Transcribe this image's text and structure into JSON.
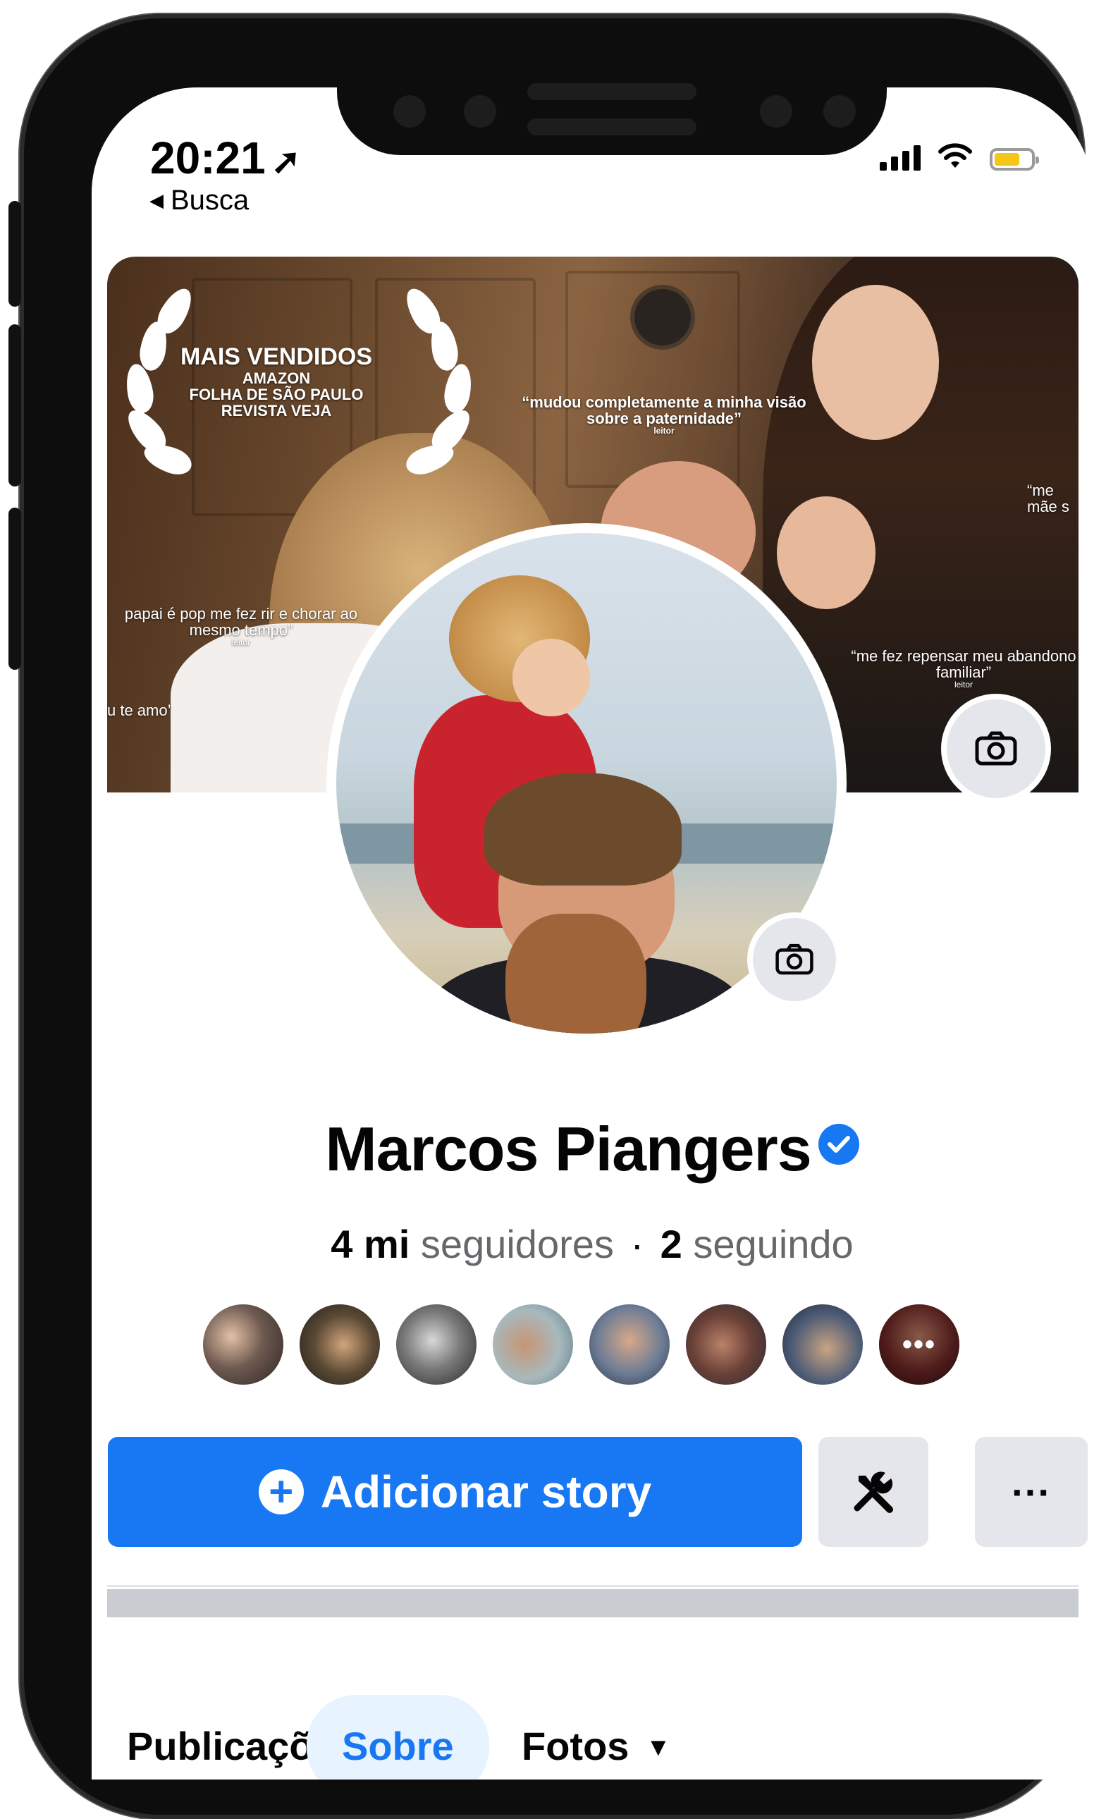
{
  "status_bar": {
    "time": "20:21",
    "back_label": "Busca",
    "battery_color": "#f5c518"
  },
  "cover": {
    "award_title": "MAIS VENDIDOS",
    "award_line1": "AMAZON",
    "award_line2": "FOLHA DE SÃO PAULO",
    "award_line3": "REVISTA VEJA",
    "quote1": "“mudou completamente a minha visão sobre a paternidade”",
    "quote1_attr": "leitor",
    "quote2": "papai é pop me fez rir e chorar ao mesmo tempo”",
    "quote2_attr": "leitor",
    "quote3": "“me fez repensar meu abandono familiar”",
    "quote3_attr": "leitor",
    "quote4": "“me",
    "quote4b": "mãe s",
    "quote5": "u te amo’"
  },
  "profile": {
    "name": "Marcos Piangers",
    "verified": true,
    "followers_count": "4 mi",
    "followers_label": "seguidores",
    "separator": "·",
    "following_count": "2",
    "following_label": "seguindo",
    "friend_more": "•••"
  },
  "actions": {
    "add_story": "Adicionar story",
    "more": "···"
  },
  "tabs": [
    {
      "label": "Publicações"
    },
    {
      "label": "Sobre"
    },
    {
      "label": "Fotos"
    }
  ],
  "colors": {
    "accent": "#1877f2",
    "button_gray": "#e4e6eb"
  }
}
